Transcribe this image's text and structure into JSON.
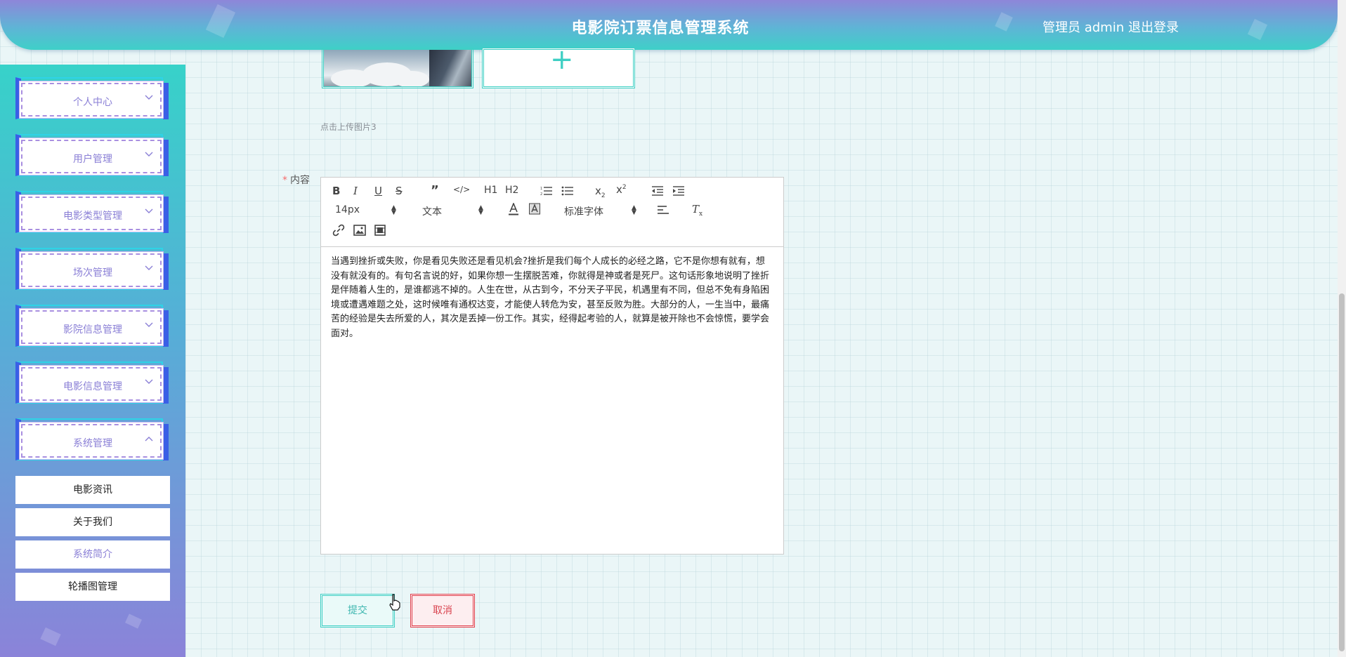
{
  "header": {
    "title": "电影院订票信息管理系统",
    "admin_label": "管理员 admin",
    "logout_label": "退出登录"
  },
  "sidebar": {
    "items": [
      {
        "label": "个人中心",
        "expanded": false
      },
      {
        "label": "用户管理",
        "expanded": false
      },
      {
        "label": "电影类型管理",
        "expanded": false
      },
      {
        "label": "场次管理",
        "expanded": false
      },
      {
        "label": "影院信息管理",
        "expanded": false
      },
      {
        "label": "电影信息管理",
        "expanded": false
      },
      {
        "label": "系统管理",
        "expanded": true
      }
    ],
    "submenu": [
      {
        "label": "电影资讯",
        "active": false
      },
      {
        "label": "关于我们",
        "active": false
      },
      {
        "label": "系统简介",
        "active": true
      },
      {
        "label": "轮播图管理",
        "active": false
      }
    ]
  },
  "form": {
    "upload_hint": "点击上传图片3",
    "content_label": "内容",
    "required_mark": "*",
    "toolbar": {
      "font_size": "14px",
      "header_select": "文本",
      "font_family": "标准字体",
      "h1": "H1",
      "h2": "H2"
    },
    "content_text": "当遇到挫折或失败，你是看见失败还是看见机会?挫折是我们每个人成长的必经之路，它不是你想有就有，想没有就没有的。有句名言说的好，如果你想一生摆脱苦难，你就得是神或者是死尸。这句话形象地说明了挫折是伴随着人生的，是谁都逃不掉的。人生在世，从古到今，不分天子平民，机遇里有不同，但总不免有身陷困境或遭遇难题之处，这时候唯有通权达变，才能使人转危为安，甚至反败为胜。大部分的人，一生当中，最痛苦的经验是失去所爱的人，其次是丢掉一份工作。其实，经得起考验的人，就算是被开除也不会惊慌，要学会面对。",
    "submit_label": "提交",
    "cancel_label": "取消"
  },
  "colors": {
    "accent_teal": "#3fcfc4",
    "accent_purple": "#8a7fd6",
    "danger": "#e0404c"
  }
}
